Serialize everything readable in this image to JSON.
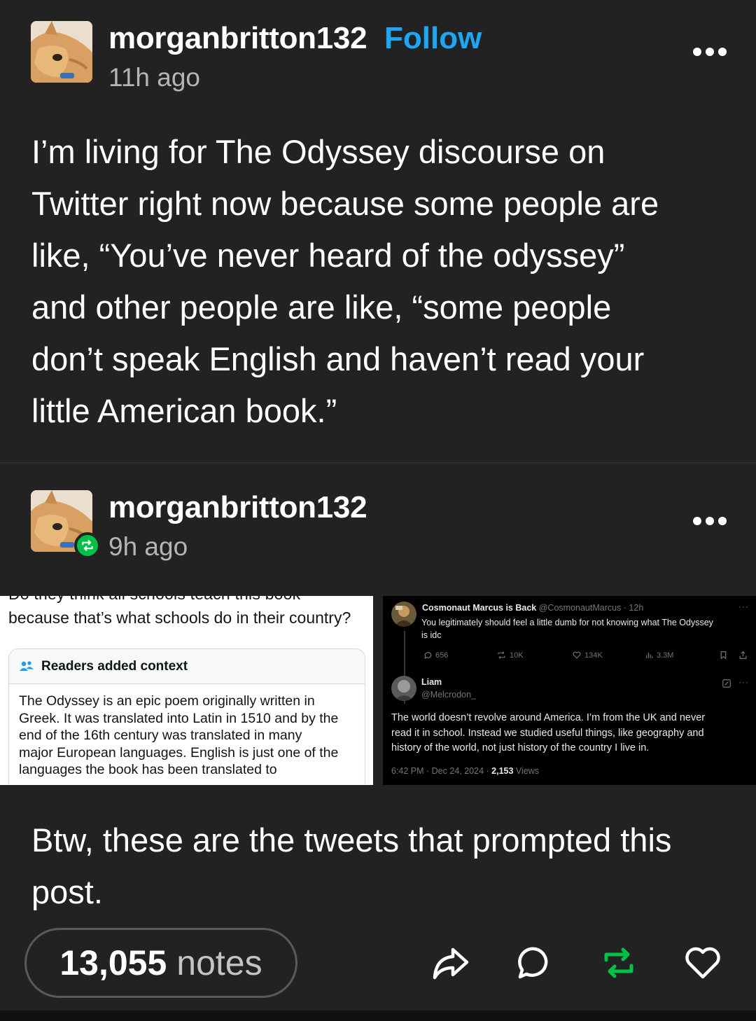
{
  "post1": {
    "username": "morganbritton132",
    "follow_label": "Follow",
    "time": "11h ago",
    "more_icon": "ellipsis-icon",
    "body_lines": [
      "I’m living for The Odyssey discourse on",
      "Twitter right now because some people are",
      "like, “You’ve never heard of the odyssey”",
      "and other people are like, “some people",
      "don’t speak English and haven’t read your",
      "little American book.”"
    ]
  },
  "post2": {
    "username": "morganbritton132",
    "time": "9h ago",
    "reblog_badge_icon": "reblog-icon",
    "more_icon": "ellipsis-icon",
    "left_screenshot": {
      "cut_line": "Do they think all schools teach this book",
      "question_line": "because that’s what schools do in their country?",
      "context_title": "Readers added context",
      "context_lines": [
        "The Odyssey is an epic poem originally written in",
        "Greek. It was translated into Latin in 1510 and by the",
        "end of the 16th century was translated in many",
        "major European languages. English is just one of the",
        "languages the book has been translated to"
      ]
    },
    "right_screenshot": {
      "tweet1": {
        "name": "Cosmonaut Marcus is Back",
        "handle_time": "@CosmonautMarcus · 12h",
        "text_lines": [
          "You legitimately should feel a little dumb for not knowing what The Odyssey",
          "is idc"
        ],
        "replies": "656",
        "reposts": "10K",
        "likes": "134K",
        "views": "3.3M"
      },
      "tweet2": {
        "name": "Liam",
        "handle": "@Melcrodon_",
        "text_lines": [
          "The world doesn’t revolve around America.  I’m from the UK and never",
          "read it in school. Instead we studied useful things, like geography and",
          "history of the world, not just history of the country I live in."
        ],
        "timestamp": "6:42 PM · Dec 24, 2024 · ",
        "views_count": "2,153",
        "views_label": " Views"
      }
    },
    "caption_lines": [
      "Btw, these are the tweets that prompted this",
      "post."
    ]
  },
  "footer": {
    "notes_count": "13,055",
    "notes_label": "notes",
    "reblog_active_color": "#00c244",
    "follow_color": "#1aa7f5"
  }
}
